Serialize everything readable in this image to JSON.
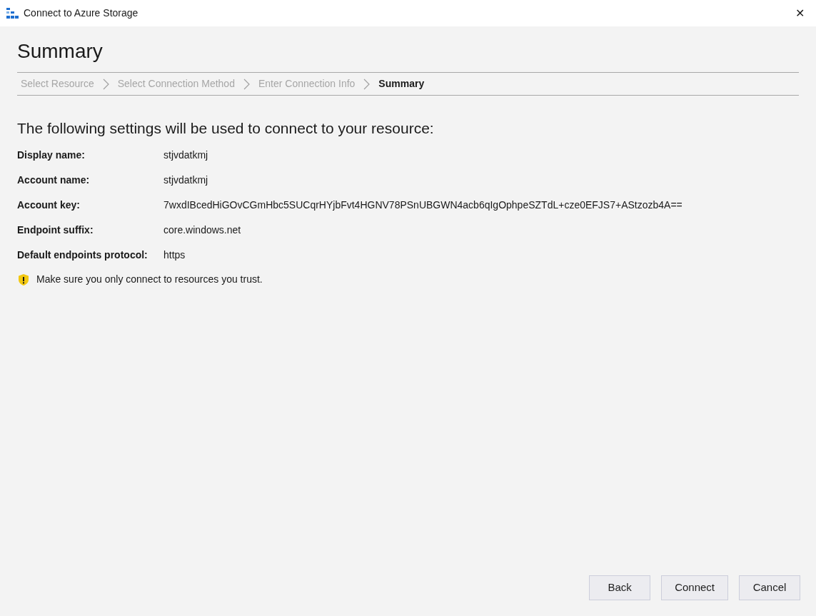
{
  "window": {
    "title": "Connect to Azure Storage",
    "close": "✕"
  },
  "page_title": "Summary",
  "steps": [
    {
      "label": "Select Resource",
      "selected": false
    },
    {
      "label": "Select Connection Method",
      "selected": false
    },
    {
      "label": "Enter Connection Info",
      "selected": false
    },
    {
      "label": "Summary",
      "selected": true
    }
  ],
  "heading": "The following settings will be used to connect to your resource:",
  "settings": [
    {
      "label": "Display name:",
      "value": "stjvdatkmj"
    },
    {
      "label": "Account name:",
      "value": "stjvdatkmj"
    },
    {
      "label": "Account key:",
      "value": "7wxdIBcedHiGOvCGmHbc5SUCqrHYjbFvt4HGNV78PSnUBGWN4acb6qIgOphpeSZTdL+cze0EFJS7+AStzozb4A=="
    },
    {
      "label": "Endpoint suffix:",
      "value": "core.windows.net"
    },
    {
      "label": "Default endpoints protocol:",
      "value": "https"
    }
  ],
  "warning": "Make sure you only connect to resources you trust.",
  "buttons": [
    "Back",
    "Connect",
    "Cancel"
  ]
}
